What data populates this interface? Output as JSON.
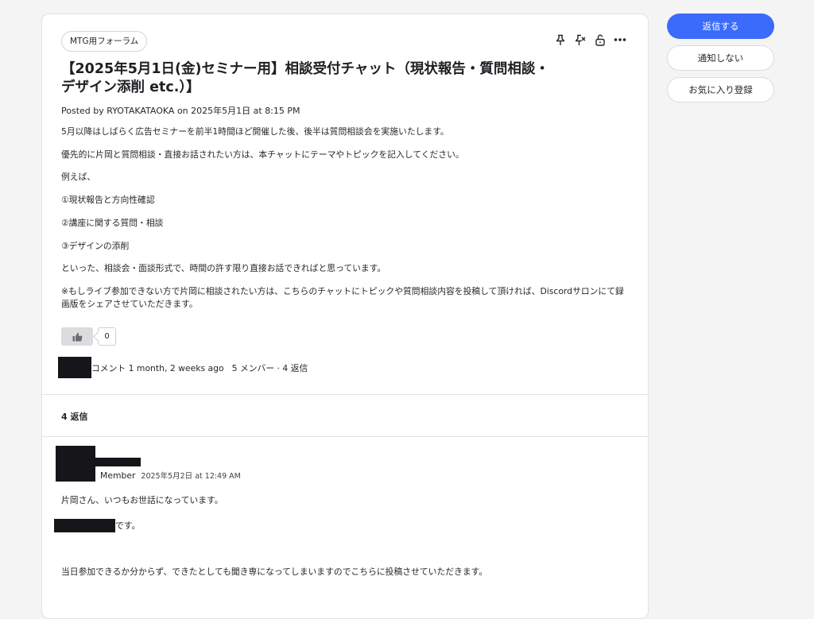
{
  "post": {
    "forum_tag": "MTG用フォーラム",
    "title": "【2025年5月1日(金)セミナー用】相談受付チャット（現状報告・質問相談・デザイン添削 etc.）】",
    "posted_line": "Posted by RYOTAKATAOKA on 2025年5月1日 at 8:15 PM",
    "paragraphs": [
      "5月以降はしばらく広告セミナーを前半1時間ほど開催した後、後半は質問相談会を実施いたします。",
      "優先的に片岡と質問相談・直接お話されたい方は、本チャットにテーマやトピックを記入してください。",
      "例えば、",
      "①現状報告と方向性確認",
      "②講座に関する質問・相談",
      "③デザインの添削",
      "といった、相談会・面談形式で、時間の許す限り直接お話できればと思っています。",
      "※もしライブ参加できない方で片岡に相談されたい方は、こちらのチャットにトピックや質問相談内容を投稿して頂ければ、Discordサロンにて録画版をシェアさせていただきます。"
    ],
    "like_count": "0",
    "comment_meta": "コメント 1 month, 2 weeks ago",
    "members_meta": "5 メンバー · 4 返信"
  },
  "toolbar": {
    "icons": [
      "pin-icon",
      "unpin-icon",
      "unlock-icon",
      "more-icon"
    ]
  },
  "replies": {
    "count_label": "4 返信",
    "first": {
      "role": "Member",
      "timestamp": "2025年5月2日 at 12:49 AM",
      "line1": "片岡さん、いつもお世話になっています。",
      "line2_suffix": "です。",
      "line3": "当日参加できるか分からず、できたとしても聞き専になってしまいますのでこちらに投稿させていただきます。"
    }
  },
  "sidebar": {
    "reply_label": "返信する",
    "notify_label": "通知しない",
    "favorite_label": "お気に入り登録"
  },
  "colors": {
    "primary": "#3b6bfa",
    "background": "#f4f4f5",
    "redaction": "#15151a"
  }
}
